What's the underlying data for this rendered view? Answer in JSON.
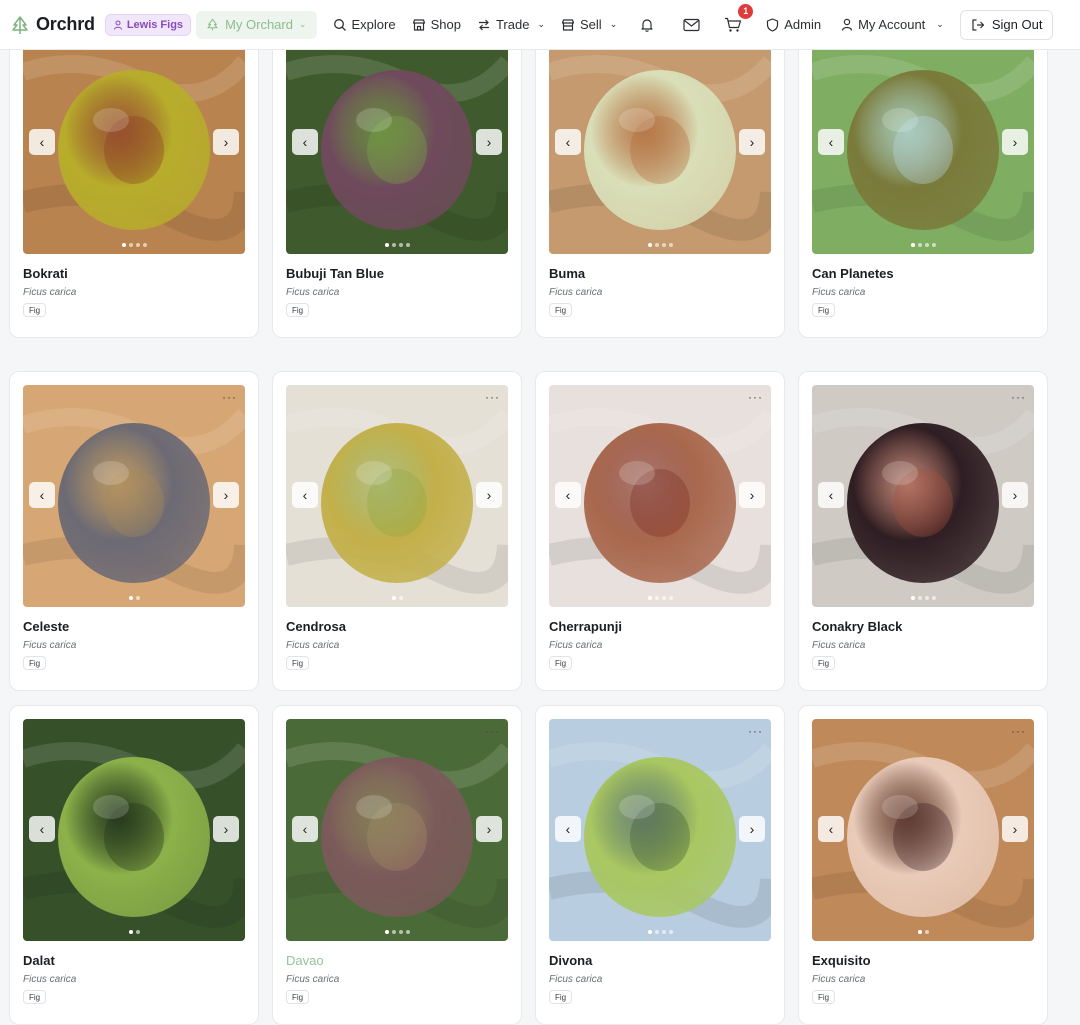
{
  "header": {
    "brand": "Orchrd",
    "user_pill": "Lewis Figs",
    "orchard_pill": "My Orchard",
    "nav": {
      "explore": "Explore",
      "shop": "Shop",
      "trade": "Trade",
      "sell": "Sell",
      "admin": "Admin",
      "account": "My Account",
      "sign_out": "Sign Out"
    },
    "cart_count": "1"
  },
  "cards": [
    {
      "name": "Bokrati",
      "species": "Ficus carica",
      "tag": "Fig",
      "dots": 4,
      "active_dot": 0,
      "colors": [
        "#b9834f",
        "#b7ad2b",
        "#8a3b22"
      ]
    },
    {
      "name": "Bubuji Tan Blue",
      "species": "Ficus carica",
      "tag": "Fig",
      "dots": 4,
      "active_dot": 0,
      "colors": [
        "#3f5a2c",
        "#6f4a5c",
        "#7fa84a"
      ]
    },
    {
      "name": "Buma",
      "species": "Ficus carica",
      "tag": "Fig",
      "dots": 4,
      "active_dot": 0,
      "colors": [
        "#c49a6e",
        "#d9dfb8",
        "#b36a3a"
      ]
    },
    {
      "name": "Can Planetes",
      "species": "Ficus carica",
      "tag": "Fig",
      "dots": 4,
      "active_dot": 0,
      "colors": [
        "#7fae63",
        "#7a7a3a",
        "#b9d6e4"
      ]
    },
    {
      "name": "Celeste",
      "species": "Ficus carica",
      "tag": "Fig",
      "dots": 2,
      "active_dot": 0,
      "colors": [
        "#d6a774",
        "#6c6a74",
        "#a58a5a"
      ]
    },
    {
      "name": "Cendrosa",
      "species": "Ficus carica",
      "tag": "Fig",
      "dots": 2,
      "active_dot": 0,
      "colors": [
        "#e4e0d6",
        "#c3b04a",
        "#8ea640"
      ]
    },
    {
      "name": "Cherrapunji",
      "species": "Ficus carica",
      "tag": "Fig",
      "dots": 4,
      "active_dot": 0,
      "colors": [
        "#e7e0dc",
        "#a9684e",
        "#7c2a20"
      ]
    },
    {
      "name": "Conakry Black",
      "species": "Ficus carica",
      "tag": "Fig",
      "dots": 4,
      "active_dot": 0,
      "colors": [
        "#cfcac4",
        "#2e1d22",
        "#a5503d"
      ]
    },
    {
      "name": "Dalat",
      "species": "Ficus carica",
      "tag": "Fig",
      "dots": 2,
      "active_dot": 0,
      "colors": [
        "#36502a",
        "#8db14a",
        "#22331a"
      ]
    },
    {
      "name": "Davao",
      "species": "Ficus carica",
      "tag": "Fig",
      "dots": 4,
      "active_dot": 0,
      "colors": [
        "#4a6b38",
        "#7b5a5a",
        "#a98c6a"
      ]
    },
    {
      "name": "Divona",
      "species": "Ficus carica",
      "tag": "Fig",
      "dots": 4,
      "active_dot": 0,
      "colors": [
        "#b8cde0",
        "#a9c761",
        "#3e5a2e"
      ]
    },
    {
      "name": "Exquisito",
      "species": "Ficus carica",
      "tag": "Fig",
      "dots": 2,
      "active_dot": 0,
      "colors": [
        "#c0895a",
        "#e9cbb9",
        "#3a1d22"
      ]
    }
  ]
}
